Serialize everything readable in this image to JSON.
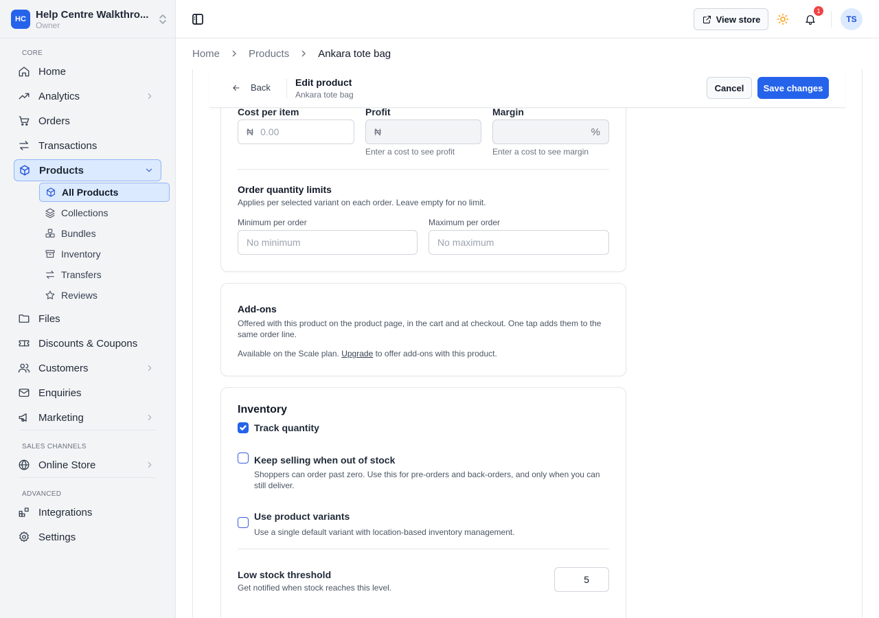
{
  "workspace": {
    "initials": "HC",
    "name": "Help Centre Walkthro...",
    "role": "Owner"
  },
  "sidebar": {
    "core_label": "CORE",
    "home": "Home",
    "analytics": "Analytics",
    "orders": "Orders",
    "transactions": "Transactions",
    "products": "Products",
    "products_sub": {
      "all": "All Products",
      "collections": "Collections",
      "bundles": "Bundles",
      "inventory": "Inventory",
      "transfers": "Transfers",
      "reviews": "Reviews"
    },
    "files": "Files",
    "discounts": "Discounts & Coupons",
    "customers": "Customers",
    "enquiries": "Enquiries",
    "marketing": "Marketing",
    "sales_label": "SALES CHANNELS",
    "online_store": "Online Store",
    "advanced_label": "ADVANCED",
    "integrations": "Integrations",
    "settings": "Settings"
  },
  "topbar": {
    "view_store": "View store",
    "notifications": "1",
    "avatar": "TS"
  },
  "breadcrumb": {
    "home": "Home",
    "products": "Products",
    "current": "Ankara tote bag"
  },
  "editbar": {
    "back": "Back",
    "title": "Edit product",
    "subtitle": "Ankara tote bag",
    "cancel": "Cancel",
    "save": "Save changes"
  },
  "pricing": {
    "cost_label": "Cost per item",
    "cost_currency": "₦",
    "cost_placeholder": "0.00",
    "profit_label": "Profit",
    "profit_currency": "₦",
    "profit_hint": "Enter a cost to see profit",
    "margin_label": "Margin",
    "margin_suffix": "%",
    "margin_hint": "Enter a cost to see margin"
  },
  "limits": {
    "title": "Order quantity limits",
    "desc": "Applies per selected variant on each order. Leave empty for no limit.",
    "min_label": "Minimum per order",
    "min_placeholder": "No minimum",
    "max_label": "Maximum per order",
    "max_placeholder": "No maximum"
  },
  "addons": {
    "title": "Add-ons",
    "desc": "Offered with this product on the product page, in the cart and at checkout. One tap adds them to the same order line.",
    "plan_pre": "Available on the Scale plan. ",
    "upgrade": "Upgrade",
    "plan_post": " to offer add-ons with this product."
  },
  "inventory": {
    "title": "Inventory",
    "track": "Track quantity",
    "track_checked": true,
    "keep_selling": "Keep selling when out of stock",
    "keep_selling_desc": "Shoppers can order past zero. Use this for pre-orders and back-orders, and only when you can still deliver.",
    "variants": "Use product variants",
    "variants_desc": "Use a single default variant with location-based inventory management.",
    "low_stock_title": "Low stock threshold",
    "low_stock_desc": "Get notified when stock reaches this level.",
    "low_stock_value": "5"
  }
}
